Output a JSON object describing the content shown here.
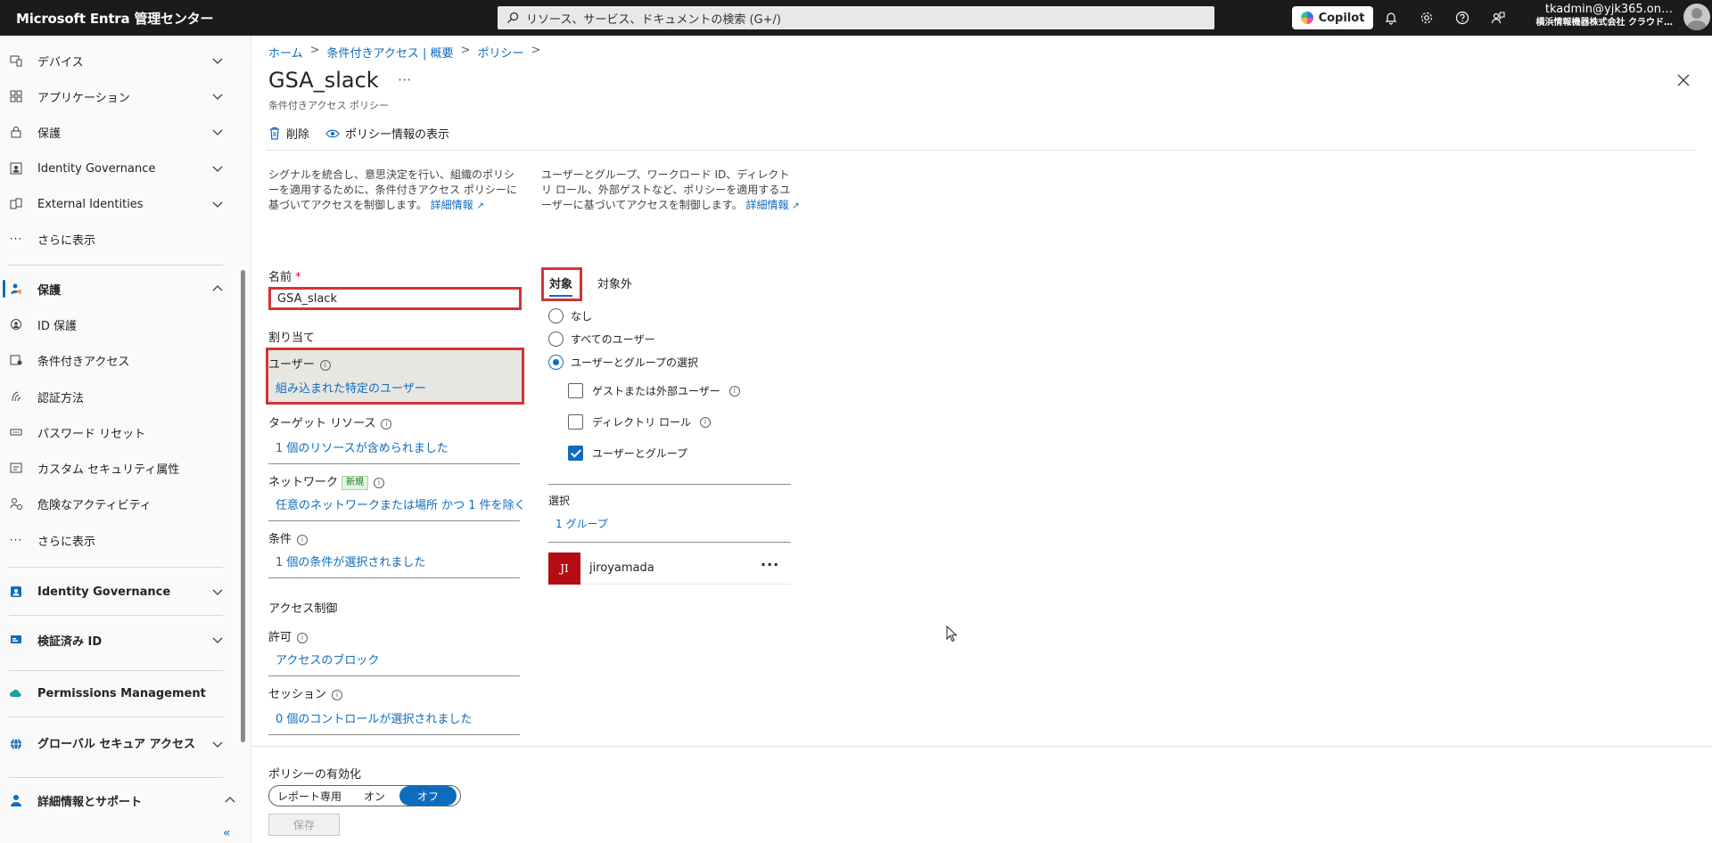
{
  "topbar": {
    "brand": "Microsoft Entra 管理センター",
    "search_placeholder": "リソース、サービス、ドキュメントの検索 (G+/)",
    "copilot_label": "Copilot",
    "account_name": "tkadmin@yjk365.on…",
    "account_org": "横浜情報機器株式会社 クラウド…"
  },
  "sidebar": {
    "top_items": [
      {
        "label": "デバイス",
        "icon": "device-icon"
      },
      {
        "label": "アプリケーション",
        "icon": "apps-icon"
      },
      {
        "label": "保護",
        "icon": "lock-icon"
      },
      {
        "label": "Identity Governance",
        "icon": "governance-icon"
      },
      {
        "label": "External Identities",
        "icon": "external-icon"
      },
      {
        "label": "さらに表示",
        "icon": "more-icon"
      }
    ],
    "protection_header": "保護",
    "protection_items": [
      {
        "label": "ID 保護",
        "icon": "id-protection-icon"
      },
      {
        "label": "条件付きアクセス",
        "icon": "conditional-access-icon"
      },
      {
        "label": "認証方法",
        "icon": "auth-methods-icon"
      },
      {
        "label": "パスワード リセット",
        "icon": "password-icon"
      },
      {
        "label": "カスタム セキュリティ属性",
        "icon": "custom-attr-icon"
      },
      {
        "label": "危険なアクティビティ",
        "icon": "risky-icon"
      },
      {
        "label": "さらに表示",
        "icon": "more-icon"
      }
    ],
    "sections": [
      {
        "label": "Identity Governance",
        "icon": "governance-icon"
      },
      {
        "label": "検証済み ID",
        "icon": "verified-id-icon"
      },
      {
        "label": "Permissions Management",
        "icon": "cloud-icon"
      },
      {
        "label": "グローバル セキュア アクセス",
        "icon": "globe-icon"
      },
      {
        "label": "詳細情報とサポート",
        "icon": "support-icon"
      }
    ],
    "collapse_glyph": "«"
  },
  "breadcrumb": [
    "ホーム",
    "条件付きアクセス | 概要",
    "ポリシー"
  ],
  "breadcrumb_sep": ">",
  "page": {
    "title": "GSA_slack",
    "more": "···",
    "subtitle": "条件付きアクセス ポリシー"
  },
  "commands": {
    "delete": "削除",
    "view_info": "ポリシー情報の表示"
  },
  "left": {
    "description": "シグナルを統合し、意思決定を行い、組織のポリシーを適用するために、条件付きアクセス ポリシーに基づいてアクセスを制御します。",
    "learn_more": "詳細情報",
    "name_label": "名前",
    "required": "*",
    "name_value": "GSA_slack",
    "assignments_label": "割り当て",
    "users_label": "ユーザー",
    "users_value": "組み込まれた特定のユーザー",
    "target_label": "ターゲット リソース",
    "target_value": "1 個のリソースが含められました",
    "network_label": "ネットワーク",
    "network_badge": "新規",
    "network_value": "任意のネットワークまたは場所 かつ 1 件を除く",
    "conditions_label": "条件",
    "conditions_value": "1 個の条件が選択されました",
    "access_controls_label": "アクセス制御",
    "grant_label": "許可",
    "grant_value": "アクセスのブロック",
    "session_label": "セッション",
    "session_value": "0 個のコントロールが選択されました"
  },
  "right": {
    "description": "ユーザーとグループ、ワークロード ID、ディレクトリ ロール、外部ゲストなど、ポリシーを適用するユーザーに基づいてアクセスを制御します。",
    "learn_more": "詳細情報",
    "tab_include": "対象",
    "tab_exclude": "対象外",
    "radio_none": "なし",
    "radio_all": "すべてのユーザー",
    "radio_select": "ユーザーとグループの選択",
    "check_guest": "ゲストまたは外部ユーザー",
    "check_roles": "ディレクトリ ロール",
    "check_users_groups": "ユーザーとグループ",
    "select_label": "選択",
    "select_value": "1 グループ",
    "member_initials": "JI",
    "member_name": "jiroyamada",
    "member_more": "···"
  },
  "footer": {
    "enable_label": "ポリシーの有効化",
    "toggle": [
      "レポート専用",
      "オン",
      "オフ"
    ],
    "selected": "オフ",
    "save": "保存"
  },
  "colors": {
    "accent": "#0f6cbd",
    "highlight": "#d13438",
    "topbar": "#1b1b1b"
  }
}
